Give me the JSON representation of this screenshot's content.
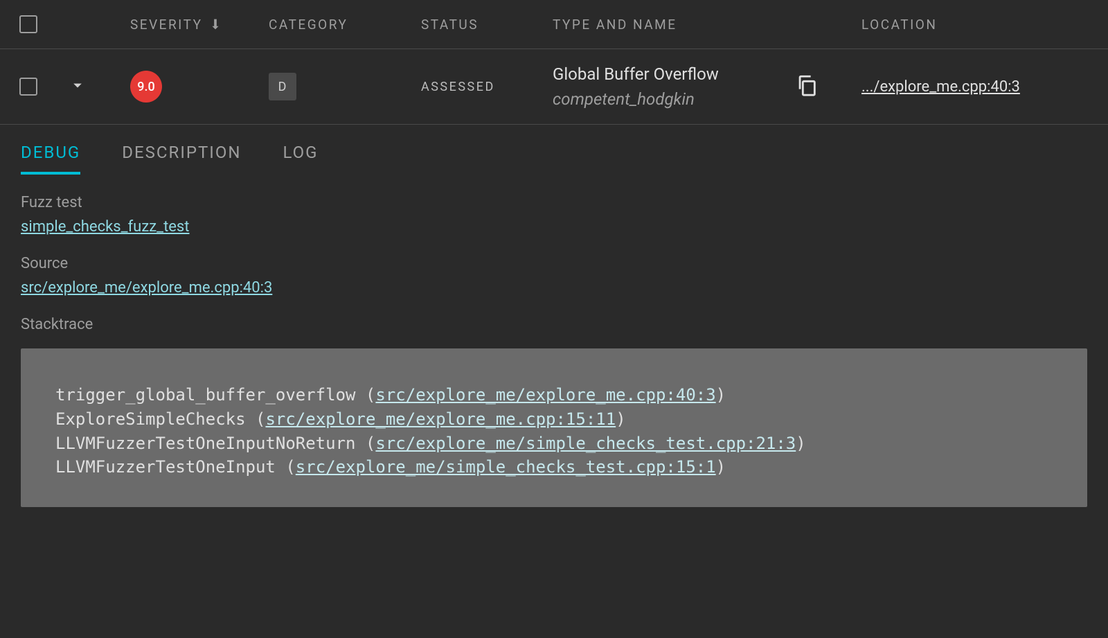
{
  "table": {
    "headers": {
      "severity": "SEVERITY",
      "category": "CATEGORY",
      "status": "STATUS",
      "type_and_name": "TYPE AND NAME",
      "location": "LOCATION"
    },
    "row": {
      "severity": "9.0",
      "category": "D",
      "status": "ASSESSED",
      "type": "Global Buffer Overflow",
      "name": "competent_hodgkin",
      "location": ".../explore_me.cpp:40:3"
    }
  },
  "tabs": {
    "debug": "DEBUG",
    "description": "DESCRIPTION",
    "log": "LOG"
  },
  "details": {
    "fuzz_test": {
      "label": "Fuzz test",
      "link": "simple_checks_fuzz_test"
    },
    "source": {
      "label": "Source",
      "link": "src/explore_me/explore_me.cpp:40:3"
    },
    "stacktrace_label": "Stacktrace"
  },
  "stacktrace": [
    {
      "fn": "trigger_global_buffer_overflow",
      "loc": "src/explore_me/explore_me.cpp:40:3"
    },
    {
      "fn": "ExploreSimpleChecks",
      "loc": "src/explore_me/explore_me.cpp:15:11"
    },
    {
      "fn": "LLVMFuzzerTestOneInputNoReturn",
      "loc": "src/explore_me/simple_checks_test.cpp:21:3"
    },
    {
      "fn": "LLVMFuzzerTestOneInput",
      "loc": "src/explore_me/simple_checks_test.cpp:15:1"
    }
  ],
  "colors": {
    "accent": "#00bcd4",
    "severity_bg": "#e53935"
  }
}
